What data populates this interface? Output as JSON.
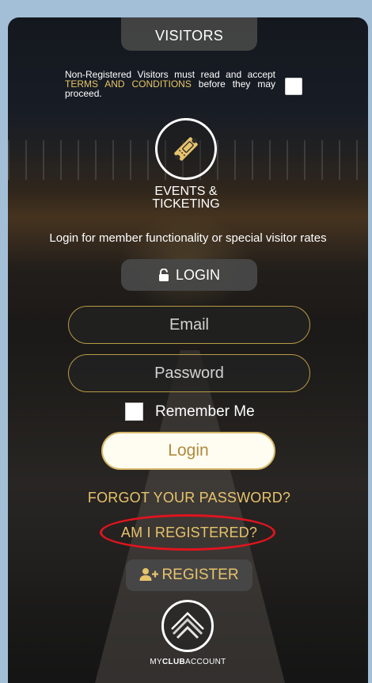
{
  "header": {
    "tab_label": "VISITORS"
  },
  "terms": {
    "text_before": "Non-Registered Visitors must read and accept ",
    "link_text": "TERMS AND CONDITIONS",
    "text_after": " before they may proceed."
  },
  "events": {
    "label_line1": "EVENTS &",
    "label_line2": "TICKETING",
    "icon": "ticket-icon"
  },
  "login": {
    "info_text": "Login for member functionality or special visitor rates",
    "tab_label": "LOGIN",
    "email_placeholder": "Email",
    "password_placeholder": "Password",
    "remember_label": "Remember Me",
    "button_label": "Login",
    "forgot_label": "FORGOT YOUR PASSWORD?",
    "registered_label": "AM I REGISTERED?"
  },
  "register": {
    "button_label": "REGISTER",
    "icon": "add-user-icon"
  },
  "brand": {
    "name_prefix": "MY",
    "name_bold": "CLUB",
    "name_suffix": "ACCOUNT"
  },
  "colors": {
    "accent_gold": "#e7c36c",
    "highlight_red": "#e0141f",
    "frame_blue": "#a3bfd8"
  }
}
